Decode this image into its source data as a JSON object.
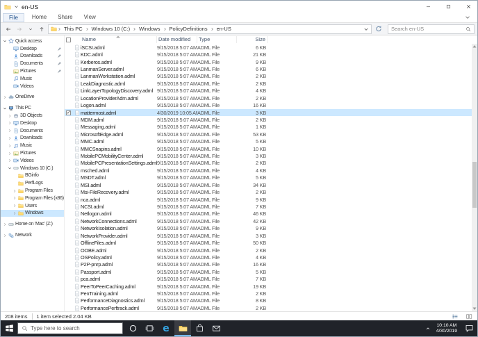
{
  "window": {
    "title": "en-US"
  },
  "ribbon": {
    "file_tab": "File",
    "tabs": [
      "Home",
      "Share",
      "View"
    ]
  },
  "address_bar": {
    "path_segments": [
      "This PC",
      "Windows 10 (C:)",
      "Windows",
      "PolicyDefinitions",
      "en-US"
    ],
    "search_placeholder": "Search en-US"
  },
  "nav": {
    "items": [
      {
        "label": "Quick access",
        "icon": "star",
        "depth": 0,
        "expander": "down"
      },
      {
        "label": "Desktop",
        "icon": "monitor",
        "depth": 1,
        "pinned": true
      },
      {
        "label": "Downloads",
        "icon": "download",
        "depth": 1,
        "pinned": true
      },
      {
        "label": "Documents",
        "icon": "document",
        "depth": 1,
        "pinned": true
      },
      {
        "label": "Pictures",
        "icon": "picture",
        "depth": 1,
        "pinned": true
      },
      {
        "label": "Music",
        "icon": "music",
        "depth": 1
      },
      {
        "label": "Videos",
        "icon": "video",
        "depth": 1
      },
      {
        "label": "OneDrive",
        "icon": "cloud",
        "depth": 0,
        "expander": "right",
        "gap": true
      },
      {
        "label": "This PC",
        "icon": "pc",
        "depth": 0,
        "expander": "down",
        "gap": true
      },
      {
        "label": "3D Objects",
        "icon": "cube",
        "depth": 1,
        "expander": "right"
      },
      {
        "label": "Desktop",
        "icon": "monitor",
        "depth": 1,
        "expander": "right"
      },
      {
        "label": "Documents",
        "icon": "document",
        "depth": 1,
        "expander": "right"
      },
      {
        "label": "Downloads",
        "icon": "download",
        "depth": 1,
        "expander": "right"
      },
      {
        "label": "Music",
        "icon": "music",
        "depth": 1,
        "expander": "right"
      },
      {
        "label": "Pictures",
        "icon": "picture",
        "depth": 1,
        "expander": "right"
      },
      {
        "label": "Videos",
        "icon": "video",
        "depth": 1,
        "expander": "right"
      },
      {
        "label": "Windows 10 (C:)",
        "icon": "drive",
        "depth": 1,
        "expander": "down"
      },
      {
        "label": "BGinfo",
        "icon": "folder",
        "depth": 2
      },
      {
        "label": "PerfLogs",
        "icon": "folder",
        "depth": 2
      },
      {
        "label": "Program Files",
        "icon": "folder",
        "depth": 2,
        "expander": "right"
      },
      {
        "label": "Program Files (x86)",
        "icon": "folder",
        "depth": 2,
        "expander": "right"
      },
      {
        "label": "Users",
        "icon": "folder",
        "depth": 2,
        "expander": "right"
      },
      {
        "label": "Windows",
        "icon": "folder",
        "depth": 2,
        "expander": "right",
        "selected": true
      },
      {
        "label": "Home on 'Mac' (Z:)",
        "icon": "drive",
        "depth": 0,
        "expander": "right",
        "gap": true
      },
      {
        "label": "Network",
        "icon": "network",
        "depth": 0,
        "expander": "right",
        "gap": true
      }
    ]
  },
  "files": {
    "columns": [
      "Name",
      "Date modified",
      "Type",
      "Size"
    ],
    "rows": [
      {
        "name": "iSCSI.adml",
        "modified": "9/15/2018 5:07 AM",
        "type": "ADML File",
        "size": "6 KB"
      },
      {
        "name": "KDC.adml",
        "modified": "9/15/2018 5:07 AM",
        "type": "ADML File",
        "size": "21 KB"
      },
      {
        "name": "Kerberos.adml",
        "modified": "9/15/2018 5:07 AM",
        "type": "ADML File",
        "size": "9 KB"
      },
      {
        "name": "LanmanServer.adml",
        "modified": "9/15/2018 5:07 AM",
        "type": "ADML File",
        "size": "6 KB"
      },
      {
        "name": "LanmanWorkstation.adml",
        "modified": "9/15/2018 5:07 AM",
        "type": "ADML File",
        "size": "2 KB"
      },
      {
        "name": "LeakDiagnostic.adml",
        "modified": "9/15/2018 5:07 AM",
        "type": "ADML File",
        "size": "2 KB"
      },
      {
        "name": "LinkLayerTopologyDiscovery.adml",
        "modified": "9/15/2018 5:07 AM",
        "type": "ADML File",
        "size": "4 KB"
      },
      {
        "name": "LocationProviderAdm.adml",
        "modified": "9/15/2018 5:07 AM",
        "type": "ADML File",
        "size": "2 KB"
      },
      {
        "name": "Logon.adml",
        "modified": "9/15/2018 5:07 AM",
        "type": "ADML File",
        "size": "16 KB"
      },
      {
        "name": "mattermost.adml",
        "modified": "4/30/2019 10:05 AM",
        "type": "ADML File",
        "size": "3 KB",
        "selected": true
      },
      {
        "name": "MDM.adml",
        "modified": "9/15/2018 5:07 AM",
        "type": "ADML File",
        "size": "2 KB"
      },
      {
        "name": "Messaging.adml",
        "modified": "9/15/2018 5:07 AM",
        "type": "ADML File",
        "size": "1 KB"
      },
      {
        "name": "MicrosoftEdge.adml",
        "modified": "9/15/2018 5:07 AM",
        "type": "ADML File",
        "size": "53 KB"
      },
      {
        "name": "MMC.adml",
        "modified": "9/15/2018 5:07 AM",
        "type": "ADML File",
        "size": "5 KB"
      },
      {
        "name": "MMCSnapins.adml",
        "modified": "9/15/2018 5:07 AM",
        "type": "ADML File",
        "size": "10 KB"
      },
      {
        "name": "MobilePCMobilityCenter.adml",
        "modified": "9/15/2018 5:07 AM",
        "type": "ADML File",
        "size": "3 KB"
      },
      {
        "name": "MobilePCPresentationSettings.adml",
        "modified": "9/15/2018 5:07 AM",
        "type": "ADML File",
        "size": "2 KB"
      },
      {
        "name": "msched.adml",
        "modified": "9/15/2018 5:07 AM",
        "type": "ADML File",
        "size": "4 KB"
      },
      {
        "name": "MSDT.adml",
        "modified": "9/15/2018 5:07 AM",
        "type": "ADML File",
        "size": "5 KB"
      },
      {
        "name": "MSI.adml",
        "modified": "9/15/2018 5:07 AM",
        "type": "ADML File",
        "size": "34 KB"
      },
      {
        "name": "Msi-FileRecovery.adml",
        "modified": "9/15/2018 5:07 AM",
        "type": "ADML File",
        "size": "2 KB"
      },
      {
        "name": "nca.adml",
        "modified": "9/15/2018 5:07 AM",
        "type": "ADML File",
        "size": "9 KB"
      },
      {
        "name": "NCSI.adml",
        "modified": "9/15/2018 5:07 AM",
        "type": "ADML File",
        "size": "7 KB"
      },
      {
        "name": "Netlogon.adml",
        "modified": "9/15/2018 5:07 AM",
        "type": "ADML File",
        "size": "46 KB"
      },
      {
        "name": "NetworkConnections.adml",
        "modified": "9/15/2018 5:07 AM",
        "type": "ADML File",
        "size": "42 KB"
      },
      {
        "name": "NetworkIsolation.adml",
        "modified": "9/15/2018 5:07 AM",
        "type": "ADML File",
        "size": "9 KB"
      },
      {
        "name": "NetworkProvider.adml",
        "modified": "9/15/2018 5:07 AM",
        "type": "ADML File",
        "size": "3 KB"
      },
      {
        "name": "OfflineFiles.adml",
        "modified": "9/15/2018 5:07 AM",
        "type": "ADML File",
        "size": "50 KB"
      },
      {
        "name": "OOBE.adml",
        "modified": "9/15/2018 5:07 AM",
        "type": "ADML File",
        "size": "2 KB"
      },
      {
        "name": "OSPolicy.adml",
        "modified": "9/15/2018 5:07 AM",
        "type": "ADML File",
        "size": "4 KB"
      },
      {
        "name": "P2P-pnrp.adml",
        "modified": "9/15/2018 5:07 AM",
        "type": "ADML File",
        "size": "16 KB"
      },
      {
        "name": "Passport.adml",
        "modified": "9/15/2018 5:07 AM",
        "type": "ADML File",
        "size": "5 KB"
      },
      {
        "name": "pca.adml",
        "modified": "9/15/2018 5:07 AM",
        "type": "ADML File",
        "size": "7 KB"
      },
      {
        "name": "PeerToPeerCaching.adml",
        "modified": "9/15/2018 5:07 AM",
        "type": "ADML File",
        "size": "19 KB"
      },
      {
        "name": "PenTraining.adml",
        "modified": "9/15/2018 5:07 AM",
        "type": "ADML File",
        "size": "2 KB"
      },
      {
        "name": "PerformanceDiagnostics.adml",
        "modified": "9/15/2018 5:07 AM",
        "type": "ADML File",
        "size": "8 KB"
      },
      {
        "name": "PerformancePerftrack.adml",
        "modified": "9/15/2018 5:07 AM",
        "type": "ADML File",
        "size": "2 KB"
      }
    ]
  },
  "status_bar": {
    "item_count": "208 items",
    "selection": "1 item selected 2.04 KB"
  },
  "taskbar": {
    "search_placeholder": "Type here to search",
    "apps": [
      {
        "icon": "edge",
        "active": false
      },
      {
        "icon": "file-explorer",
        "active": true
      },
      {
        "icon": "store",
        "active": false
      },
      {
        "icon": "mail",
        "active": false
      }
    ],
    "clock": {
      "time": "10:10 AM",
      "date": "4/30/2019"
    }
  },
  "colors": {
    "selection": "#cce8ff",
    "taskbar": "#202329",
    "accent": "#76b9ed"
  }
}
